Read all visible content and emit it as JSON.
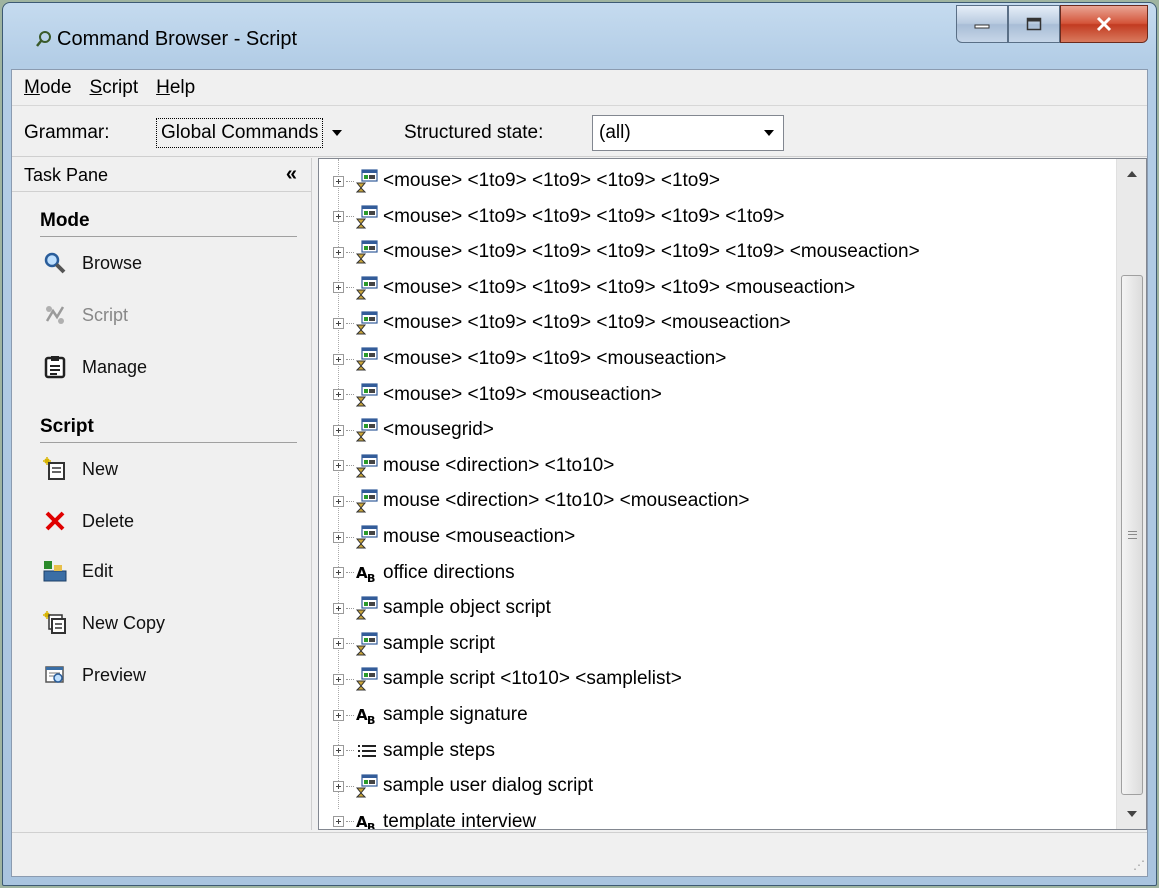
{
  "window": {
    "title": "Command Browser - Script"
  },
  "menu": [
    {
      "label": "Mode",
      "accel": "M",
      "rest": "ode"
    },
    {
      "label": "Script",
      "accel": "S",
      "rest": "cript"
    },
    {
      "label": "Help",
      "accel": "H",
      "rest": "elp"
    }
  ],
  "toolbar": {
    "grammar_label": "Grammar:",
    "grammar_value": "Global Commands",
    "structured_label": "Structured state:",
    "structured_value": "(all)"
  },
  "task_pane": {
    "title": "Task Pane",
    "collapse_glyph": "«",
    "mode_section": "Mode",
    "mode_items": [
      {
        "label": "Browse",
        "icon": "magnifier-icon"
      },
      {
        "label": "Script",
        "icon": "script-icon",
        "disabled": true
      },
      {
        "label": "Manage",
        "icon": "clipboard-icon"
      }
    ],
    "script_section": "Script",
    "script_items": [
      {
        "label": "New",
        "icon": "new-icon"
      },
      {
        "label": "Delete",
        "icon": "delete-x-icon"
      },
      {
        "label": "Edit",
        "icon": "edit-icon"
      },
      {
        "label": "New Copy",
        "icon": "new-copy-icon"
      },
      {
        "label": "Preview",
        "icon": "preview-icon"
      }
    ]
  },
  "tree_items": [
    {
      "label": "<mouse> <1to9> <1to9> <1to9> <1to9>",
      "icon": "macro-icon"
    },
    {
      "label": "<mouse> <1to9> <1to9> <1to9> <1to9> <1to9>",
      "icon": "macro-icon"
    },
    {
      "label": "<mouse> <1to9> <1to9> <1to9> <1to9> <1to9> <mouseaction>",
      "icon": "macro-icon"
    },
    {
      "label": "<mouse> <1to9> <1to9> <1to9> <1to9> <mouseaction>",
      "icon": "macro-icon"
    },
    {
      "label": "<mouse> <1to9> <1to9> <1to9> <mouseaction>",
      "icon": "macro-icon"
    },
    {
      "label": "<mouse> <1to9> <1to9> <mouseaction>",
      "icon": "macro-icon"
    },
    {
      "label": "<mouse> <1to9> <mouseaction>",
      "icon": "macro-icon"
    },
    {
      "label": "<mousegrid>",
      "icon": "macro-icon"
    },
    {
      "label": "mouse <direction> <1to10>",
      "icon": "macro-icon"
    },
    {
      "label": "mouse <direction> <1to10> <mouseaction>",
      "icon": "macro-icon"
    },
    {
      "label": "mouse <mouseaction>",
      "icon": "macro-icon"
    },
    {
      "label": "office directions",
      "icon": "text-ab-icon"
    },
    {
      "label": "sample object script",
      "icon": "macro-icon"
    },
    {
      "label": "sample script",
      "icon": "macro-icon"
    },
    {
      "label": "sample script <1to10> <samplelist>",
      "icon": "macro-icon"
    },
    {
      "label": "sample signature",
      "icon": "text-ab-icon"
    },
    {
      "label": "sample steps",
      "icon": "list-steps-icon"
    },
    {
      "label": "sample user dialog script",
      "icon": "macro-icon"
    },
    {
      "label": "template interview",
      "icon": "text-ab-icon"
    }
  ],
  "colors": {
    "title_bar": "#b3cde6",
    "close_button": "#c23b21",
    "window_bg": "#f0f0f0"
  }
}
